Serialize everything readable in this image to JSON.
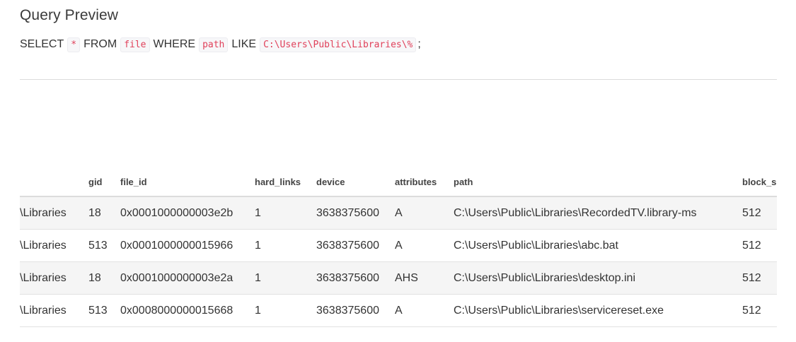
{
  "title": "Query Preview",
  "query": {
    "select": "SELECT",
    "star": "*",
    "from": "FROM",
    "table": "file",
    "where": "WHERE",
    "column": "path",
    "like": "LIKE",
    "pattern": "C:\\Users\\Public\\Libraries\\%",
    "terminator": ";"
  },
  "table": {
    "columns": [
      "",
      "gid",
      "file_id",
      "hard_links",
      "device",
      "attributes",
      "path",
      "block_s"
    ],
    "rows": [
      [
        "\\Libraries",
        "18",
        "0x0001000000003e2b",
        "1",
        "3638375600",
        "A",
        "C:\\Users\\Public\\Libraries\\RecordedTV.library-ms",
        "512"
      ],
      [
        "\\Libraries",
        "513",
        "0x0001000000015966",
        "1",
        "3638375600",
        "A",
        "C:\\Users\\Public\\Libraries\\abc.bat",
        "512"
      ],
      [
        "\\Libraries",
        "18",
        "0x0001000000003e2a",
        "1",
        "3638375600",
        "AHS",
        "C:\\Users\\Public\\Libraries\\desktop.ini",
        "512"
      ],
      [
        "\\Libraries",
        "513",
        "0x0008000000015668",
        "1",
        "3638375600",
        "A",
        "C:\\Users\\Public\\Libraries\\servicereset.exe",
        "512"
      ]
    ]
  }
}
